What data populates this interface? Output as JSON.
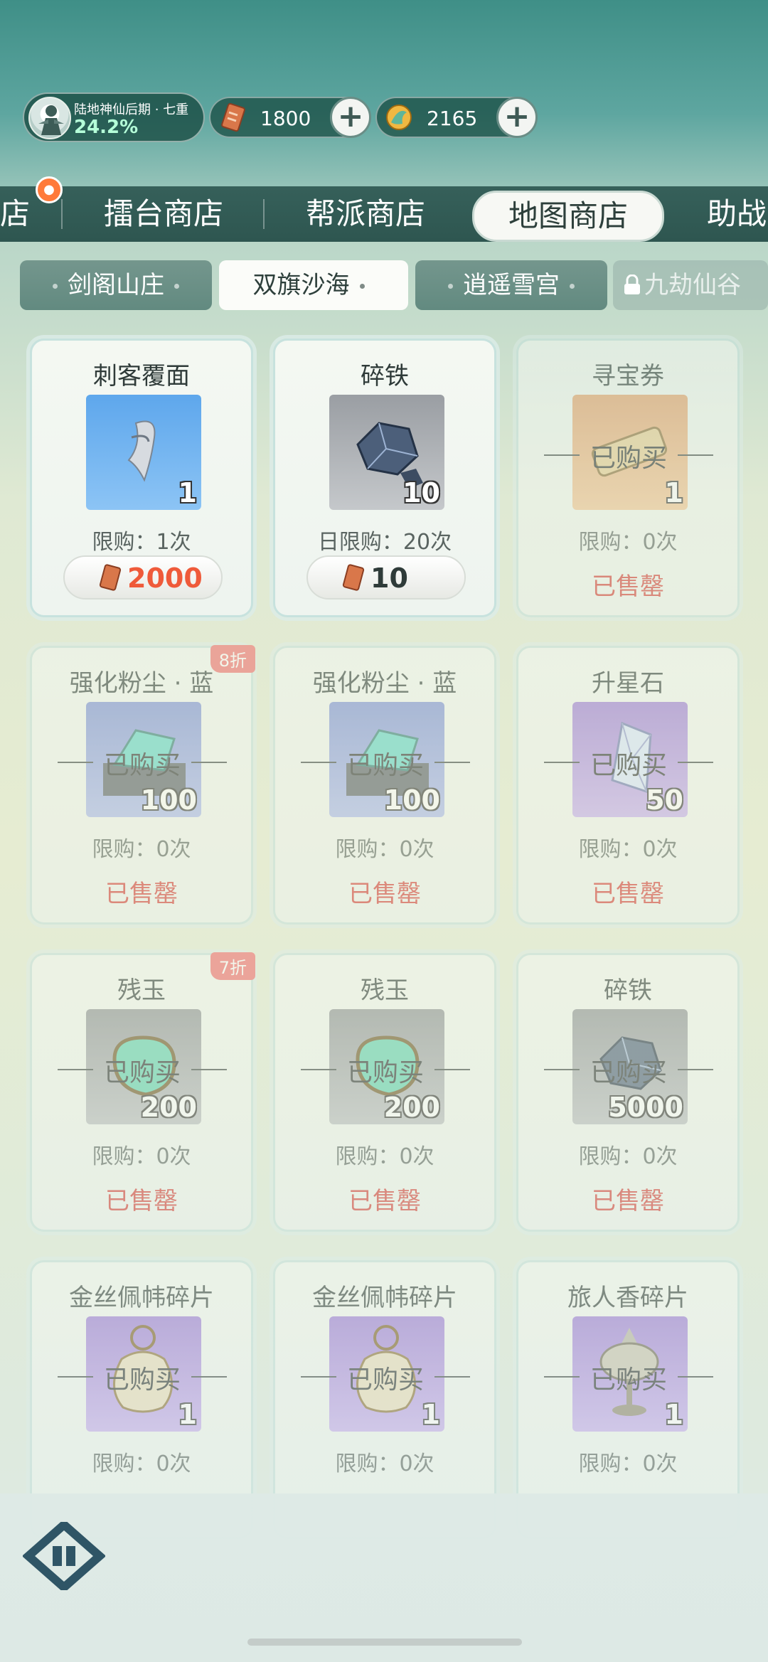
{
  "player": {
    "realm": "陆地神仙后期 · 七重",
    "progress": "24.2%"
  },
  "currencies": [
    {
      "name": "map-token",
      "value": "1800",
      "color": "#d9774a"
    },
    {
      "name": "jade-coin",
      "value": "2165",
      "color": "#f0b842"
    }
  ],
  "main_tabs": [
    "店",
    "擂台商店",
    "帮派商店",
    "地图商店",
    "助战"
  ],
  "main_tab_active": "地图商店",
  "sub_tabs": [
    "剑阁山庄",
    "双旗沙海",
    "逍遥雪宫",
    "九劫仙谷"
  ],
  "sub_tab_active": "双旗沙海",
  "items": [
    {
      "name": "刺客覆面",
      "qty": "1",
      "limit": "限购：1次",
      "price": "2000",
      "state": "available",
      "image": "blue",
      "discount": ""
    },
    {
      "name": "碎铁",
      "qty": "10",
      "limit": "日限购：20次",
      "price": "10",
      "state": "available",
      "image": "gray",
      "discount": ""
    },
    {
      "name": "寻宝券",
      "qty": "1",
      "limit": "限购：0次",
      "state": "soldout",
      "image": "orange",
      "discount": ""
    },
    {
      "name": "强化粉尘 · 蓝",
      "qty": "100",
      "limit": "限购：0次",
      "state": "soldout",
      "image": "bluepurple",
      "discount": "8折"
    },
    {
      "name": "强化粉尘 · 蓝",
      "qty": "100",
      "limit": "限购：0次",
      "state": "soldout",
      "image": "bluepurple",
      "discount": ""
    },
    {
      "name": "升星石",
      "qty": "50",
      "limit": "限购：0次",
      "state": "soldout",
      "image": "purple",
      "discount": ""
    },
    {
      "name": "残玉",
      "qty": "200",
      "limit": "限购：0次",
      "state": "soldout",
      "image": "gray2",
      "discount": "7折"
    },
    {
      "name": "残玉",
      "qty": "200",
      "limit": "限购：0次",
      "state": "soldout",
      "image": "gray2",
      "discount": ""
    },
    {
      "name": "碎铁",
      "qty": "5000",
      "limit": "限购：0次",
      "state": "soldout",
      "image": "gray2",
      "discount": ""
    },
    {
      "name": "金丝佩帏碎片",
      "qty": "1",
      "limit": "限购：0次",
      "state": "soldout",
      "image": "purple",
      "discount": ""
    },
    {
      "name": "金丝佩帏碎片",
      "qty": "1",
      "limit": "限购：0次",
      "state": "soldout",
      "image": "purple",
      "discount": ""
    },
    {
      "name": "旅人香碎片",
      "qty": "1",
      "limit": "限购：0次",
      "state": "soldout",
      "image": "purple",
      "discount": ""
    }
  ],
  "labels": {
    "bought": "已购买",
    "sold_out": "已售罄"
  }
}
